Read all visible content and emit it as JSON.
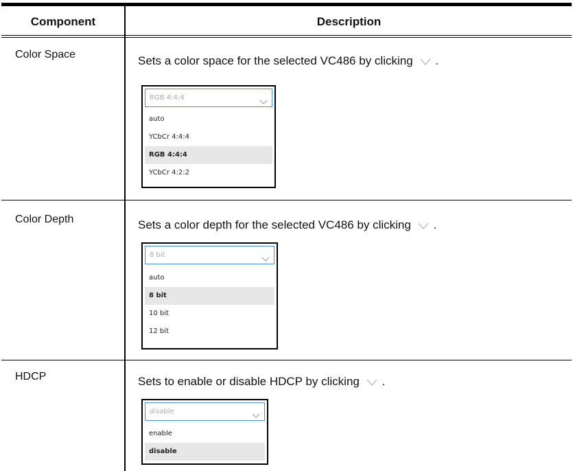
{
  "header": {
    "component": "Component",
    "description": "Description"
  },
  "rows": [
    {
      "component": "Color Space",
      "description": "Sets a color space for the selected VC486 by clicking",
      "dropdown": {
        "value": "RGB 4:4:4",
        "options": [
          "auto",
          "YCbCr 4:4:4",
          "RGB 4:4:4",
          "YCbCr 4:2:2"
        ],
        "selected": "RGB 4:4:4"
      }
    },
    {
      "component": "Color Depth",
      "description": "Sets a color depth for the selected VC486 by clicking",
      "dropdown": {
        "value": "8 bit",
        "options": [
          "auto",
          "8 bit",
          "10 bit",
          "12 bit"
        ],
        "selected": "8 bit"
      }
    },
    {
      "component": "HDCP",
      "description": "Sets to enable or disable HDCP by clicking",
      "dropdown": {
        "value": "disable",
        "options": [
          "enable",
          "disable"
        ],
        "selected": "disable"
      }
    }
  ],
  "punctuation": ".",
  "colors": {
    "select_border": "#4a90d9",
    "selected_option_bg": "#e7e7e7",
    "chevron": "#bfbfbf"
  }
}
